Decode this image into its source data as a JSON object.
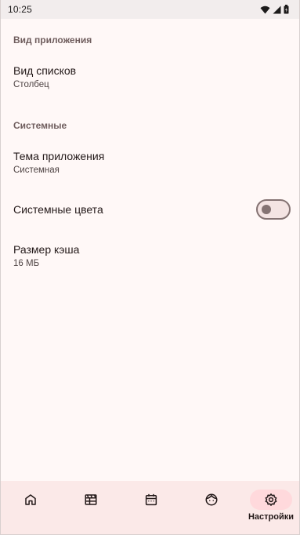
{
  "status_bar": {
    "time": "10:25"
  },
  "sections": [
    {
      "header": "Вид приложения",
      "items": [
        {
          "title": "Вид списков",
          "subtitle": "Столбец"
        }
      ]
    },
    {
      "header": "Системные",
      "items": [
        {
          "title": "Тема приложения",
          "subtitle": "Системная"
        },
        {
          "title": "Системные цвета",
          "toggle_on": false
        },
        {
          "title": "Размер кэша",
          "subtitle": "16 МБ"
        }
      ]
    }
  ],
  "bottom_nav": {
    "items": [
      {
        "icon": "home-icon",
        "label": ""
      },
      {
        "icon": "news-icon",
        "label": ""
      },
      {
        "icon": "calendar-icon",
        "label": ""
      },
      {
        "icon": "face-icon",
        "label": ""
      },
      {
        "icon": "gear-icon",
        "label": "Настройки",
        "active": true
      }
    ]
  },
  "colors": {
    "background": "#fff8f7",
    "nav_background": "#fbe9e8",
    "active_pill": "#ffd9dc",
    "section_header": "#6f5d5d",
    "toggle_outline": "#857373"
  }
}
